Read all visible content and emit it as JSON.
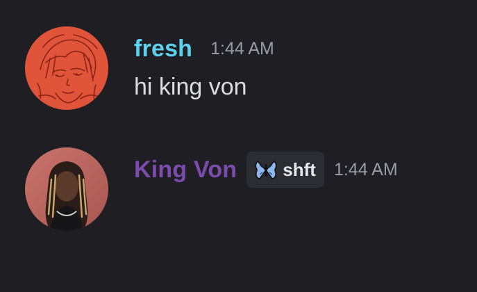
{
  "messages": [
    {
      "username": "fresh",
      "username_color": "#5ed1ee",
      "avatar_icon": "anime-sketch-avatar",
      "timestamp": "1:44 AM",
      "content": "hi king von"
    },
    {
      "username": "King Von",
      "username_color": "#7b4cad",
      "avatar_icon": "portrait-avatar",
      "badge": {
        "icon": "butterfly-icon",
        "label": "shft"
      },
      "timestamp": "1:44 AM",
      "content": ""
    }
  ]
}
